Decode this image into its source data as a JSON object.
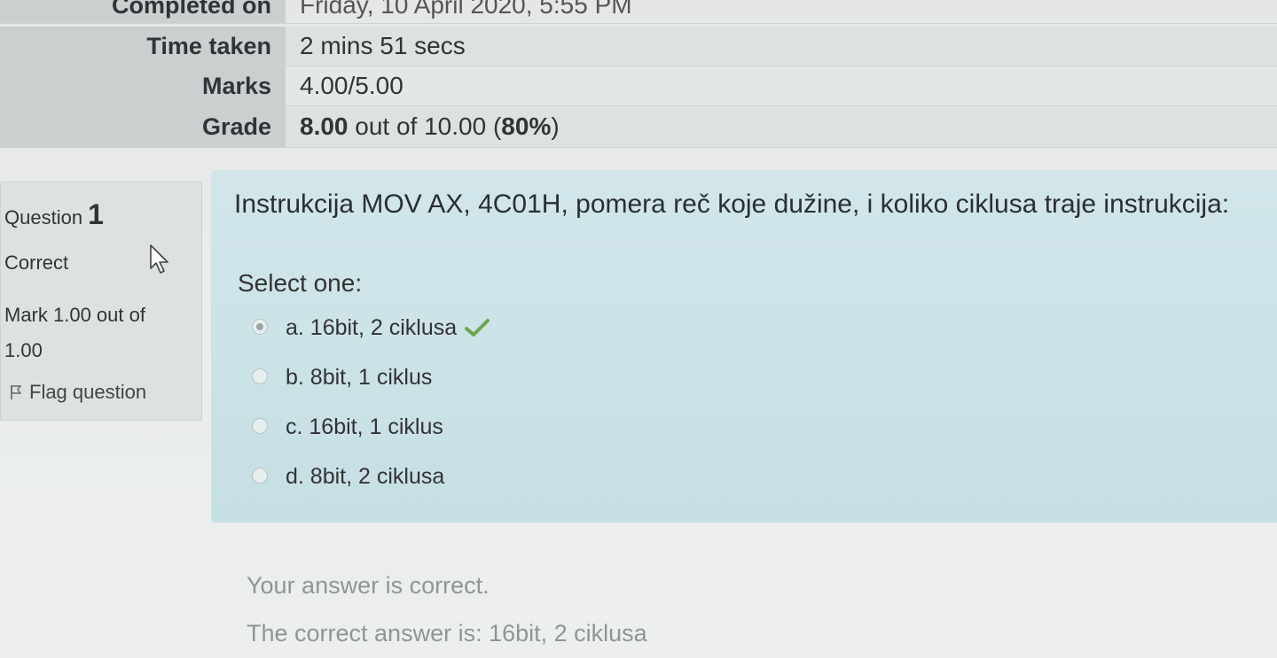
{
  "summary": {
    "completed_label": "Completed on",
    "completed_value": "Friday, 10 April 2020, 5:55 PM",
    "time_label": "Time taken",
    "time_value": "2 mins 51 secs",
    "marks_label": "Marks",
    "marks_value": "4.00/5.00",
    "grade_label": "Grade",
    "grade_bold": "8.00",
    "grade_mid": " out of 10.00 (",
    "grade_pct": "80%",
    "grade_end": ")"
  },
  "question_info": {
    "label": "Question",
    "number": "1",
    "state": "Correct",
    "mark": "Mark 1.00 out of 1.00",
    "flag_label": "Flag question"
  },
  "question": {
    "text": "Instrukcija MOV AX, 4C01H, pomera reč koje dužine, i koliko ciklusa traje instrukcija:",
    "prompt": "Select one:",
    "answers": [
      {
        "label": "a. 16bit, 2 ciklusa",
        "checked": true,
        "correct": true
      },
      {
        "label": "b. 8bit, 1 ciklus",
        "checked": false
      },
      {
        "label": "c. 16bit, 1 ciklus",
        "checked": false
      },
      {
        "label": "d. 8bit, 2 ciklusa",
        "checked": false
      }
    ]
  },
  "feedback": {
    "result": "Your answer is correct.",
    "correct_answer": "The correct answer is: 16bit, 2 ciklusa"
  },
  "icons": {
    "flag": "flag-icon",
    "check": "check-icon",
    "cursor": "mouse-cursor-icon"
  },
  "colors": {
    "content_bg": "#c6dfe4",
    "check_green": "#6aa84f"
  }
}
